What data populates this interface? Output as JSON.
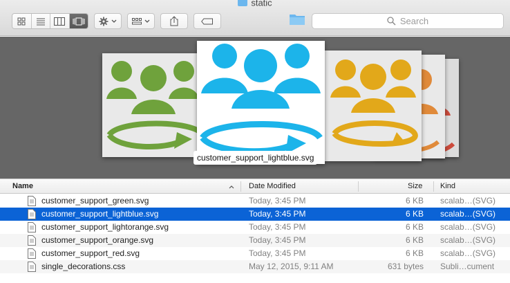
{
  "window": {
    "title": "static"
  },
  "toolbar": {
    "views": [
      "icon-view",
      "list-view",
      "column-view",
      "coverflow-view"
    ],
    "active_view": 3,
    "search_placeholder": "Search"
  },
  "coverflow": {
    "selected_caption": "customer_support_lightblue.svg",
    "colors": {
      "green": "#6fa23c",
      "lightblue": "#1cb4ea",
      "lightorange": "#e2a81a",
      "orange": "#e08a3a",
      "red": "#cc4b3c"
    }
  },
  "list": {
    "columns": {
      "name": "Name",
      "date": "Date Modified",
      "size": "Size",
      "kind": "Kind"
    },
    "rows": [
      {
        "name": "customer_support_green.svg",
        "date": "Today, 3:45 PM",
        "size": "6 KB",
        "kind": "scalab…(SVG)"
      },
      {
        "name": "customer_support_lightblue.svg",
        "date": "Today, 3:45 PM",
        "size": "6 KB",
        "kind": "scalab…(SVG)"
      },
      {
        "name": "customer_support_lightorange.svg",
        "date": "Today, 3:45 PM",
        "size": "6 KB",
        "kind": "scalab…(SVG)"
      },
      {
        "name": "customer_support_orange.svg",
        "date": "Today, 3:45 PM",
        "size": "6 KB",
        "kind": "scalab…(SVG)"
      },
      {
        "name": "customer_support_red.svg",
        "date": "Today, 3:45 PM",
        "size": "6 KB",
        "kind": "scalab…(SVG)"
      },
      {
        "name": "single_decorations.css",
        "date": "May 12, 2015, 9:11 AM",
        "size": "631 bytes",
        "kind": "Subli…cument"
      }
    ],
    "selected_index": 1
  }
}
